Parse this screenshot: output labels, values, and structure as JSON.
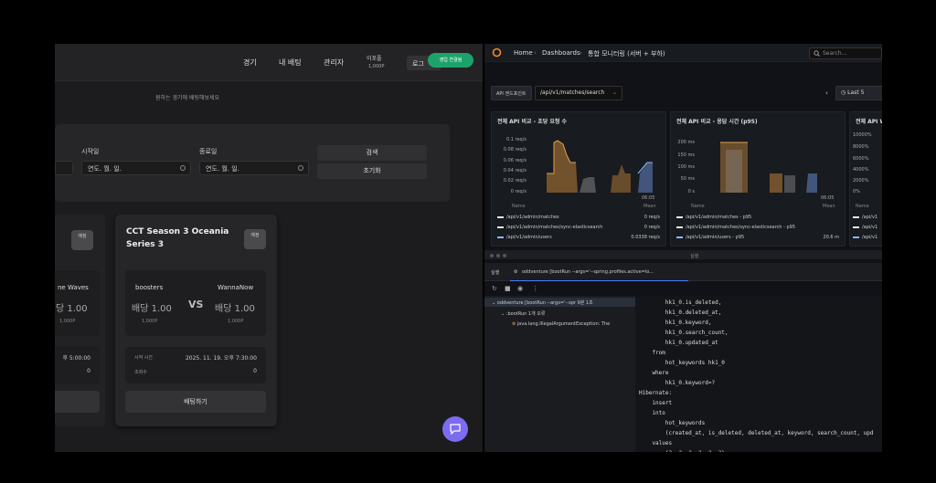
{
  "betting_app": {
    "nav": [
      "경기",
      "내 배팅",
      "관리자"
    ],
    "points_label": "이포플",
    "points_value": "1,000P",
    "login_label": "로그",
    "pill_label": "영업 연결됨",
    "hint": "원하는 경기에 배팅해보세요",
    "filter": {
      "start_label": "시작일",
      "end_label": "종료일",
      "date_placeholder": "연도. 월. 일.",
      "search_btn": "검색",
      "reset_btn": "초기화"
    },
    "left_card": {
      "team": "ne Waves",
      "odds": "당 1.00",
      "points": "1,000P",
      "time": "후 5:00:00",
      "count": "0",
      "badge": "예정"
    },
    "card": {
      "title": "CCT Season 3 Oceania Series 3",
      "badge": "예정",
      "team_a": "boosters",
      "team_b": "WannaNow",
      "odds_a": "배당 1.00",
      "odds_b": "배당 1.00",
      "points_a": "1,000P",
      "points_b": "1,000P",
      "vs": "VS",
      "start_key": "시작 시간",
      "start_val": "2025. 11. 19. 오후 7:30:00",
      "bettors_key": "조회수",
      "bettors_val": "0",
      "bet_btn": "배팅하기"
    }
  },
  "grafana": {
    "breadcrumb": [
      "Home",
      "Dashboards",
      "통합 모니터링 (서버 + 부하)"
    ],
    "search_placeholder": "Search...",
    "api_label": "API 엔드포인트",
    "api_value": "/api/v1/matches/search",
    "time_range": "Last 5",
    "panels": [
      {
        "title": "전체 API 비교 - 초당 요청 수",
        "yticks": [
          "0.1 req/s",
          "0.08 req/s",
          "0.06 req/s",
          "0.04 req/s",
          "0.02 req/s",
          "0 req/s"
        ],
        "xtick": "06:05",
        "legend_head": [
          "Name",
          "Mean"
        ],
        "legend": [
          {
            "name": "/api/v1/admin/matches",
            "val": "0 req/s",
            "color": "#e8e8e8"
          },
          {
            "name": "/api/v1/admin/matches/sync-elasticsearch",
            "val": "0 req/s",
            "color": "#e8e8e8"
          },
          {
            "name": "/api/v1/admin/users",
            "val": "0.0338 req/s",
            "color": "#8ab8ff"
          }
        ]
      },
      {
        "title": "전체 API 비교 - 응답 시간 (p95)",
        "yticks": [
          "200 ms",
          "150 ms",
          "100 ms",
          "50 ms",
          "0 s"
        ],
        "xtick": "06:05",
        "legend_head": [
          "Name",
          "Mean"
        ],
        "legend": [
          {
            "name": "/api/v1/admin/matches - p95",
            "val": "",
            "color": "#e8e8e8"
          },
          {
            "name": "/api/v1/admin/matches/sync-elasticsearch - p95",
            "val": "",
            "color": "#e8e8e8"
          },
          {
            "name": "/api/v1/admin/users - p95",
            "val": "20.6 m",
            "color": "#8ab8ff"
          }
        ]
      },
      {
        "title": "전체 API W",
        "yticks": [
          "10000%",
          "8000%",
          "6000%",
          "4000%",
          "2000%",
          "0%"
        ],
        "legend_head": [
          "Name"
        ],
        "legend": [
          {
            "name": "/api/v1",
            "color": "#e8e8e8"
          },
          {
            "name": "/api/v1",
            "color": "#e8e8e8"
          },
          {
            "name": "/api/v1",
            "color": "#8ab8ff"
          }
        ]
      }
    ],
    "colors": {
      "orange": "#c98a3c",
      "blue": "#6b8fd8",
      "gray": "#8c8c8c"
    }
  },
  "ide": {
    "window_title": "실행",
    "tab_run": "실행",
    "tab_config": "oddventure [bootRun --args='--spring.profiles.active=lo...",
    "tree": [
      "oddventure [bootRun --args='--spr 9분 1초",
      ":bootRun 1개 오류",
      "java.lang.IllegalArgumentException: The"
    ],
    "console": [
      "        hk1_0.is_deleted,",
      "        hk1_0.deleted_at,",
      "        hk1_0.keyword,",
      "        hk1_0.search_count,",
      "        hk1_0.updated_at",
      "    from",
      "        hot_keywords hk1_0",
      "    where",
      "        hk1_0.keyword=?",
      "Hibernate:",
      "    insert",
      "    into",
      "        hot_keywords",
      "        (created_at, is_deleted, deleted_at, keyword, search_count, upd",
      "    values",
      "        (?, ?, ?, ?, ?, ?)"
    ]
  }
}
